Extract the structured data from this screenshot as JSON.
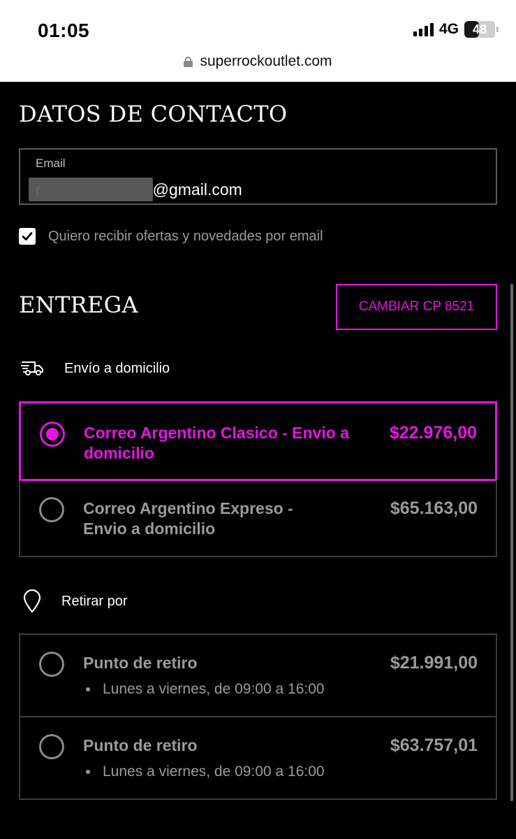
{
  "status_bar": {
    "time": "01:05",
    "network": "4G",
    "battery": "48"
  },
  "browser": {
    "url": "superrockoutlet.com"
  },
  "contact": {
    "heading": "DATOS DE CONTACTO",
    "email_label": "Email",
    "email_prefix": "r",
    "email_suffix": "@gmail.com",
    "newsletter_label": "Quiero recibir ofertas y novedades por email",
    "newsletter_checked": true
  },
  "delivery": {
    "heading": "ENTREGA",
    "change_cp_label": "CAMBIAR CP 8521",
    "home_group_label": "Envío a domicilio",
    "pickup_group_label": "Retirar por",
    "home_options": [
      {
        "title": "Correo Argentino Clasico - Envio a domicilio",
        "price": "$22.976,00",
        "selected": true
      },
      {
        "title": "Correo Argentino Expreso - Envio a domicilio",
        "price": "$65.163,00",
        "selected": false
      }
    ],
    "pickup_options": [
      {
        "title": "Punto de retiro",
        "price": "$21.991,00",
        "detail": "Lunes a viernes, de 09:00 a 16:00",
        "selected": false
      },
      {
        "title": "Punto de retiro",
        "price": "$63.757,01",
        "detail": "Lunes a viernes, de 09:00 a 16:00",
        "selected": false
      }
    ]
  },
  "colors": {
    "accent": "#e614e6",
    "background": "#000000",
    "muted_text": "#9a9a9a"
  }
}
